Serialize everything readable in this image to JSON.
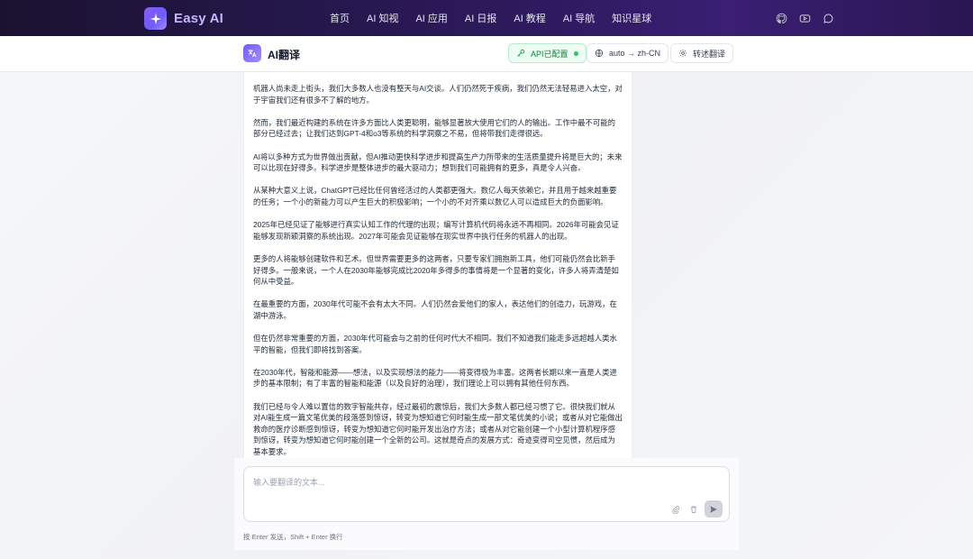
{
  "app": {
    "name": "Easy AI",
    "logo_icon": "sparkle-icon"
  },
  "nav": {
    "items": [
      "首页",
      "AI 知视",
      "AI 应用",
      "AI 日报",
      "AI 教程",
      "AI 导航",
      "知识星球"
    ],
    "icons": [
      "github-icon",
      "youtube-icon",
      "chat-icon"
    ]
  },
  "tool": {
    "title": "AI翻译",
    "api_status": "API已配置",
    "lang_pair": "auto → zh-CN",
    "mode": "转述翻译"
  },
  "content": {
    "paragraphs": [
      "机器人尚未走上街头，我们大多数人也没有整天与AI交谈。人们仍然死于疾病，我们仍然无法轻易进入太空，对于宇宙我们还有很多不了解的地方。",
      "然而，我们最近构建的系统在许多方面比人类更聪明，能够显著放大使用它们的人的输出。工作中最不可能的部分已经过去；让我们达到GPT-4和o3等系统的科学洞察之不易，但将带我们走得很远。",
      "AI将以多种方式为世界做出贡献，但AI推动更快科学进步和提高生产力所带来的生活质量提升将是巨大的；未来可以比现在好得多。科学进步是整体进步的最大驱动力；想到我们可能拥有的更多，真是令人兴奋。",
      "从某种大意义上说，ChatGPT已经比任何曾经活过的人类都更强大。数亿人每天依赖它，并且用于越来越重要的任务；一个小的新能力可以产生巨大的积极影响；一个小的不对齐乘以数亿人可以造成巨大的负面影响。",
      "2025年已经见证了能够进行真实认知工作的代理的出现；编写计算机代码将永远不再相同。2026年可能会见证能够发现新颖洞察的系统出现。2027年可能会见证能够在现实世界中执行任务的机器人的出现。",
      "更多的人将能够创建软件和艺术。但世界需要更多的这两者，只要专家们拥抱新工具，他们可能仍然会比新手好得多。一般来说，一个人在2030年能够完成比2020年多得多的事情将是一个显著的变化，许多人将弄清楚如何从中受益。",
      "在最重要的方面，2030年代可能不会有太大不同。人们仍然会爱他们的家人，表达他们的创造力，玩游戏，在湖中游泳。",
      "但在仍然非常重要的方面，2030年代可能会与之前的任何时代大不相同。我们不知道我们能走多远超越人类水平的智能，但我们即将找到答案。",
      "在2030年代，智能和能源——想法，以及实现想法的能力——将变得极为丰富。这两者长期以来一直是人类进步的基本限制；有了丰富的智能和能源（以及良好的治理），我们理论上可以拥有其他任何东西。",
      "我们已经与令人难以置信的数字智能共存，经过最初的震惊后，我们大多数人都已经习惯了它。很快我们就从对AI能生成一篇文笔优美的段落感到惊讶，转变为想知道它何时能生成一部文笔优美的小说；或者从对它能做出救命的医疗诊断感到惊讶，转变为想知道它何时能开发出治疗方法；或者从对它能创建一个小型计算机程序感到惊讶，转变为想知道它何时能创建一个全新的公司。这就是奇点的发展方式：奇迹变得司空见惯，然后成为基本要求。"
    ]
  },
  "input": {
    "placeholder": "输入要翻译的文本...",
    "hint": "按 Enter 发送，Shift + Enter 换行",
    "icons": [
      "paperclip-icon",
      "trash-icon",
      "send-icon"
    ]
  },
  "colors": {
    "accent": "#7c5cfc",
    "status_green": "#22c55e",
    "nav_bg": "#24174a"
  }
}
